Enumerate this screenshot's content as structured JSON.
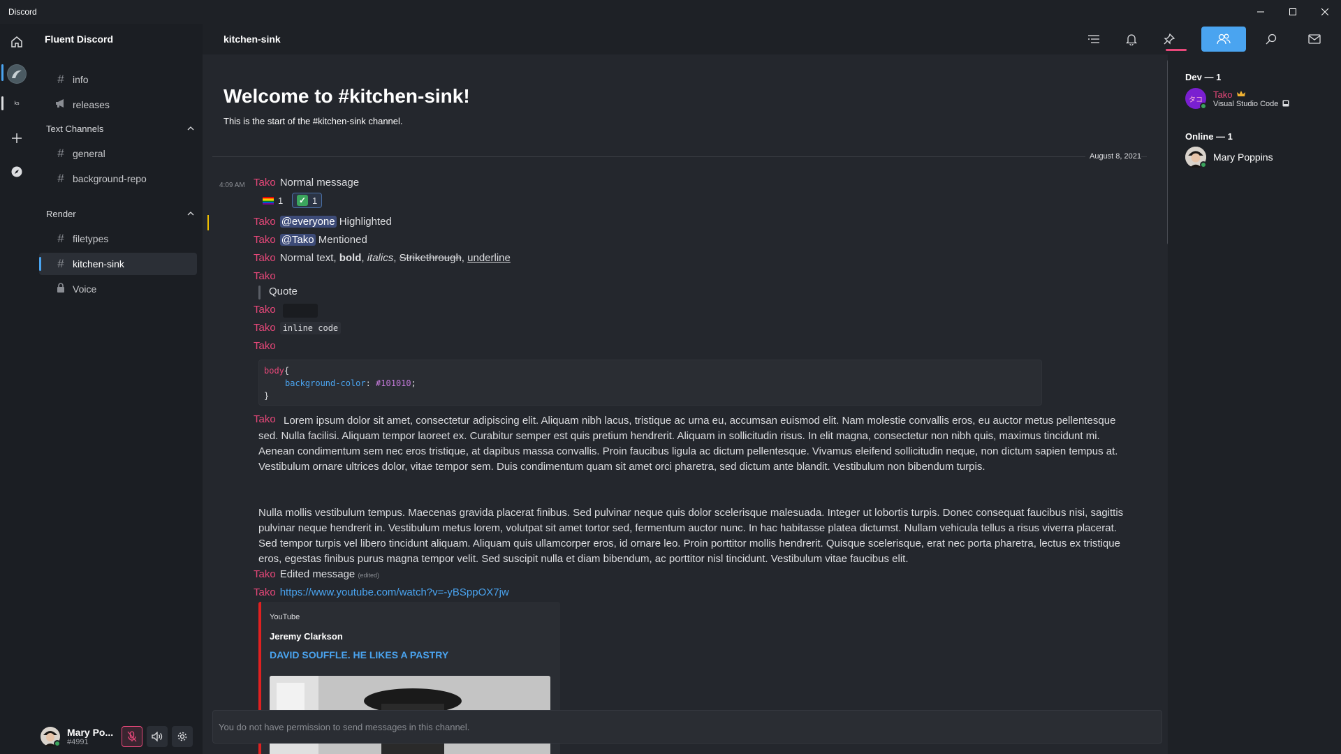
{
  "window": {
    "title": "Discord",
    "controls": [
      "minimize",
      "maximize",
      "close"
    ]
  },
  "guild": {
    "name": "Fluent Discord"
  },
  "channels": {
    "top": [
      {
        "name": "info",
        "icon": "hash-icon"
      },
      {
        "name": "releases",
        "icon": "megaphone-icon"
      }
    ],
    "categories": [
      {
        "name": "Text Channels",
        "channels": [
          {
            "name": "general",
            "icon": "hash-icon"
          },
          {
            "name": "background-repo",
            "icon": "hash-icon"
          }
        ]
      },
      {
        "name": "Render",
        "channels": [
          {
            "name": "filetypes",
            "icon": "hash-icon"
          },
          {
            "name": "kitchen-sink",
            "icon": "hash-icon",
            "active": true
          },
          {
            "name": "Voice",
            "icon": "lock-icon"
          }
        ]
      }
    ]
  },
  "user": {
    "name": "Mary Po...",
    "tag": "#4991",
    "status": "online"
  },
  "header": {
    "channel": "kitchen-sink"
  },
  "welcome": {
    "title": "Welcome to #kitchen-sink!",
    "subtitle": "This is the start of the #kitchen-sink channel."
  },
  "date_divider": "August 8, 2021",
  "messages": {
    "first": {
      "time": "4:09 AM",
      "author": "Tako",
      "text": "Normal message"
    },
    "reactions": [
      {
        "emoji": "rainbow-flag",
        "count": "1"
      },
      {
        "emoji": "check-mark",
        "count": "1"
      }
    ],
    "highlighted": {
      "author": "Tako",
      "mention": "@everyone",
      "text": "Highlighted"
    },
    "mentioned": {
      "author": "Tako",
      "mention": "@Tako",
      "text": "Mentioned"
    },
    "formatting": {
      "author": "Tako",
      "normal": "Normal text, ",
      "bold": "bold",
      "sep1": ", ",
      "italics": "italics",
      "sep2": ", ",
      "strike": "Strikethrough",
      "sep3": ", ",
      "underline": "underline"
    },
    "quote": {
      "author": "Tako",
      "text": "Quote"
    },
    "spoiler": {
      "author": "Tako"
    },
    "inline_code": {
      "author": "Tako",
      "code": "inline code"
    },
    "code_block": {
      "author": "Tako",
      "selector": "body",
      "open": "{",
      "property": "background-color",
      "colon": ": ",
      "value": "#101010",
      "semi": ";",
      "close": "}"
    },
    "lorem": {
      "author": "Tako",
      "p1": "Lorem ipsum dolor sit amet, consectetur adipiscing elit. Aliquam nibh lacus, tristique ac urna eu, accumsan euismod elit. Nam molestie convallis eros, eu auctor metus pellentesque sed. Nulla facilisi. Aliquam tempor laoreet ex. Curabitur semper est quis pretium hendrerit. Aliquam in sollicitudin risus. In elit magna, consectetur non nibh quis, maximus tincidunt mi. Aenean condimentum sem nec eros tristique, at dapibus massa convallis. Proin faucibus ligula ac dictum pellentesque. Vivamus eleifend sollicitudin neque, non dictum sapien tempus at. Vestibulum ornare ultrices dolor, vitae tempor sem. Duis condimentum quam sit amet orci pharetra, sed dictum ante blandit. Vestibulum non bibendum turpis.",
      "p2": "Nulla mollis vestibulum tempus. Maecenas gravida placerat finibus. Sed pulvinar neque quis dolor scelerisque malesuada. Integer ut lobortis turpis. Donec consequat faucibus nisi, sagittis pulvinar neque hendrerit in. Vestibulum metus lorem, volutpat sit amet tortor sed, fermentum auctor nunc. In hac habitasse platea dictumst. Nullam vehicula tellus a risus viverra placerat. Sed tempor turpis vel libero tincidunt aliquam. Aliquam quis ullamcorper eros, id ornare leo. Proin porttitor mollis hendrerit. Quisque scelerisque, erat nec porta pharetra, lectus ex tristique eros, egestas finibus purus magna tempor velit. Sed suscipit nulla et diam bibendum, ac porttitor nisl tincidunt. Vestibulum vitae faucibus elit."
    },
    "edited": {
      "author": "Tako",
      "text": "Edited message",
      "flag": "(edited)"
    },
    "link": {
      "author": "Tako",
      "url": "https://www.youtube.com/watch?v=-yBSppOX7jw"
    },
    "embed": {
      "provider": "YouTube",
      "author": "Jeremy Clarkson",
      "title": "DAVID SOUFFLE. HE LIKES A PASTRY"
    }
  },
  "composer": {
    "placeholder": "You do not have permission to send messages in this channel."
  },
  "members": {
    "groups": [
      {
        "label": "Dev — 1",
        "members": [
          {
            "name": "Tako",
            "activity": "Visual Studio Code",
            "avatar_text": "タコ"
          }
        ]
      },
      {
        "label": "Online — 1",
        "members": [
          {
            "name": "Mary Poppins"
          }
        ]
      }
    ]
  },
  "colors": {
    "accent": "#4aa4f0",
    "author": "#e8487a",
    "online": "#3ba55d",
    "background": "#24272d",
    "sidebar": "#1b1e23"
  }
}
